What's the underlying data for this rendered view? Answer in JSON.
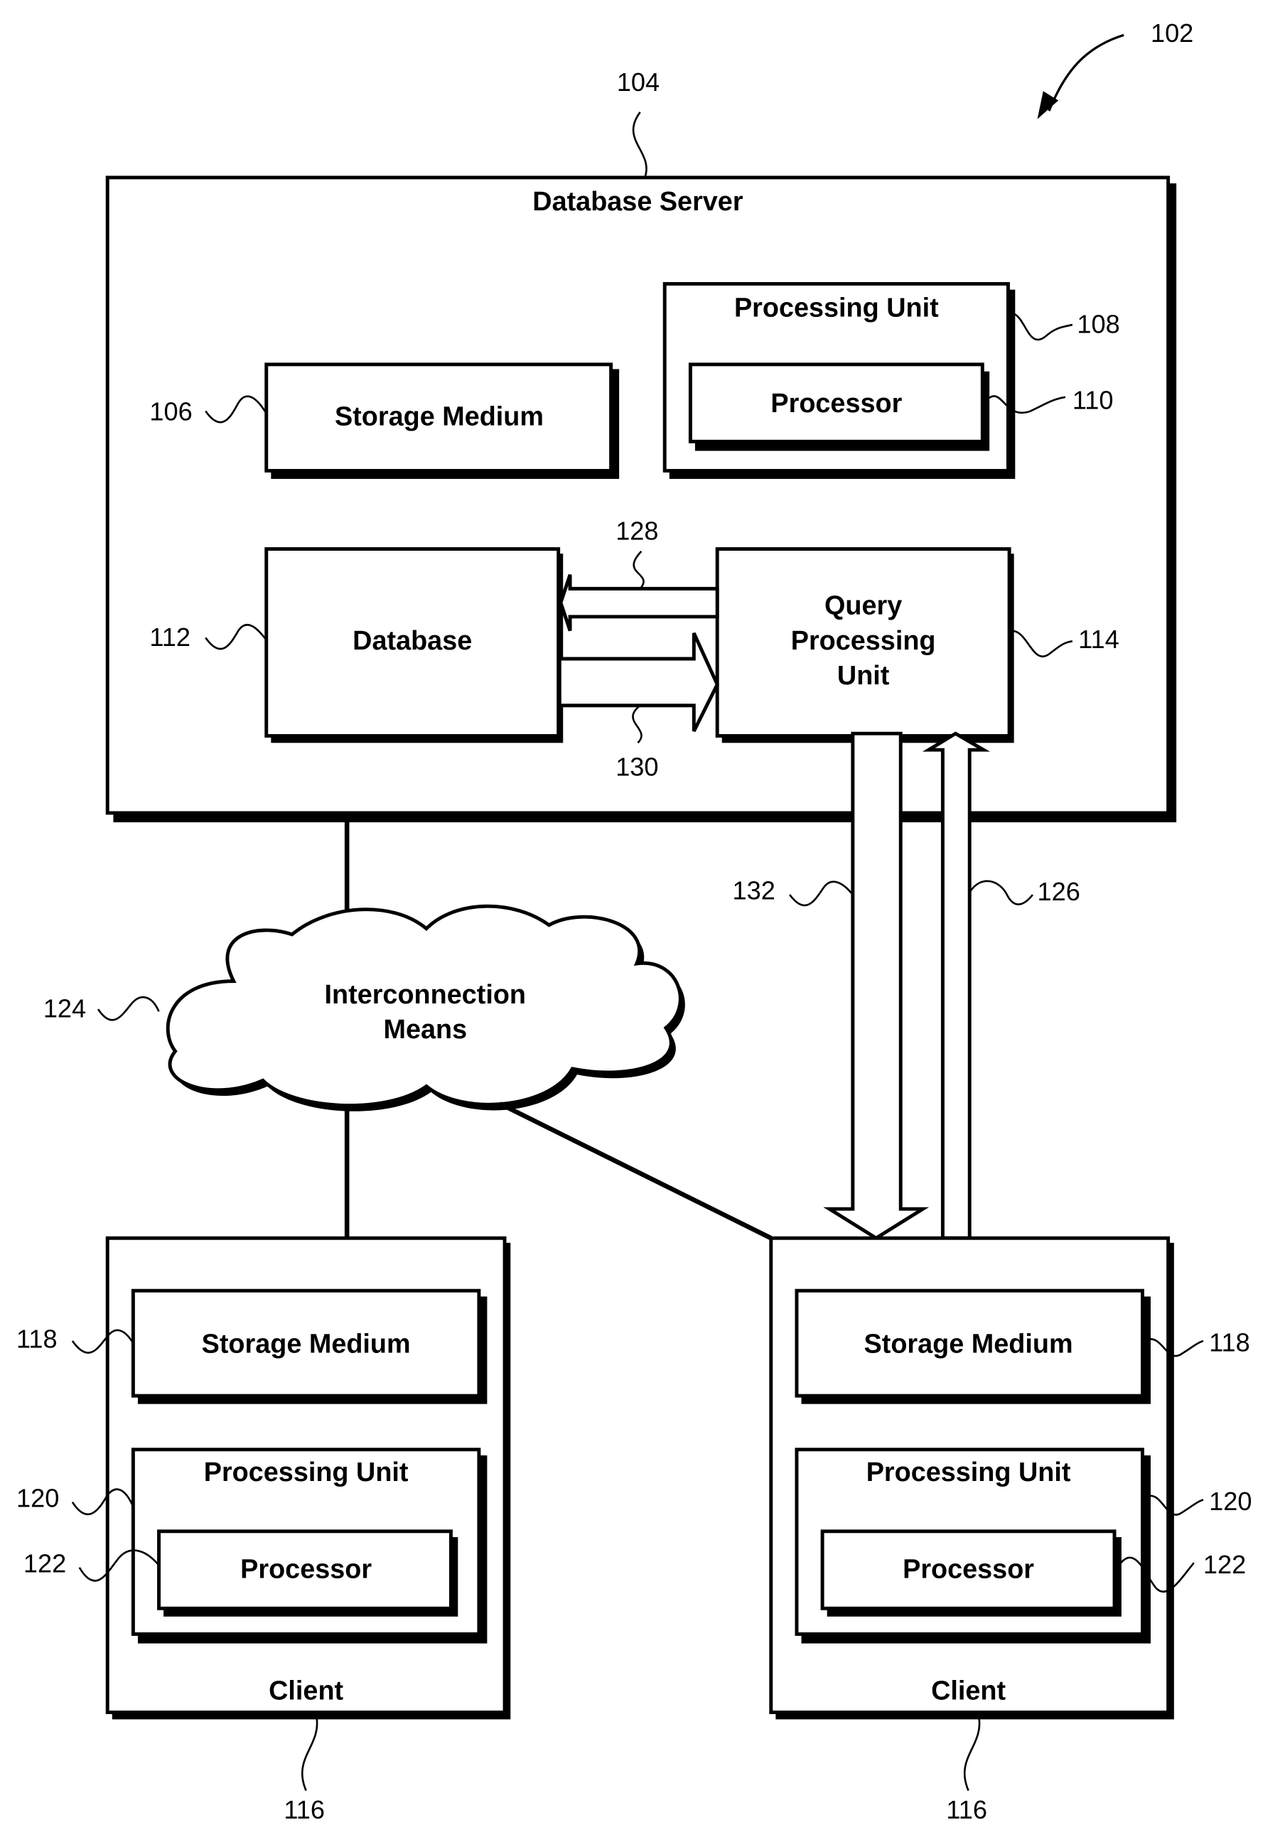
{
  "figure": {
    "ref": "102"
  },
  "server": {
    "title": "Database Server",
    "ref": "104",
    "storage": {
      "label": "Storage Medium",
      "ref": "106"
    },
    "processing_unit": {
      "label": "Processing Unit",
      "ref": "108"
    },
    "processor": {
      "label": "Processor",
      "ref": "110"
    },
    "database": {
      "label": "Database",
      "ref": "112"
    },
    "query_unit": {
      "label_lines": [
        "Query",
        "Processing",
        "Unit"
      ],
      "ref": "114"
    },
    "arrow_to_db": {
      "ref": "128"
    },
    "arrow_to_qpu": {
      "ref": "130"
    }
  },
  "network": {
    "label_lines": [
      "Interconnection",
      "Means"
    ],
    "ref": "124"
  },
  "links": {
    "client_to_qpu": {
      "ref": "126"
    },
    "qpu_to_client": {
      "ref": "132"
    }
  },
  "clients": [
    {
      "title": "Client",
      "ref": "116",
      "storage": {
        "label": "Storage Medium",
        "ref": "118"
      },
      "processing_unit": {
        "label": "Processing Unit",
        "ref": "120"
      },
      "processor": {
        "label": "Processor",
        "ref": "122"
      }
    },
    {
      "title": "Client",
      "ref": "116",
      "storage": {
        "label": "Storage Medium",
        "ref": "118"
      },
      "processing_unit": {
        "label": "Processing Unit",
        "ref": "120"
      },
      "processor": {
        "label": "Processor",
        "ref": "122"
      }
    }
  ]
}
